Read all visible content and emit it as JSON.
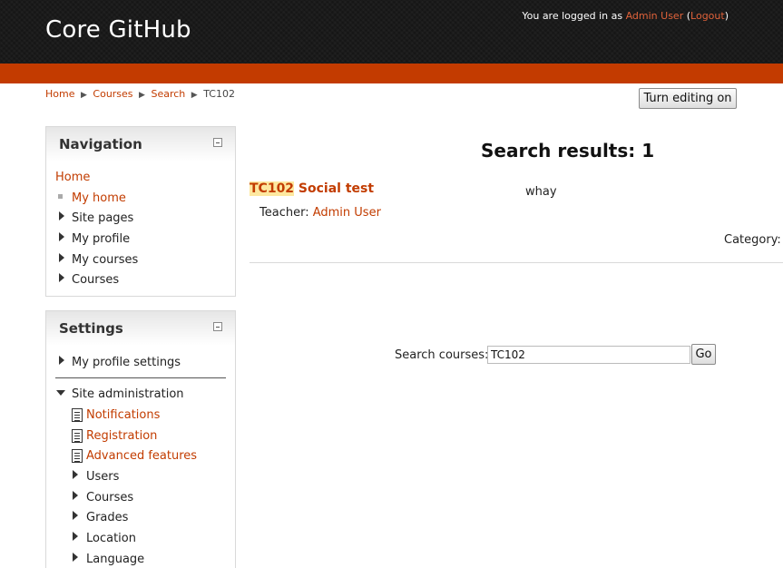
{
  "header": {
    "site_title": "Core GitHub",
    "login_prefix": "You are logged in as ",
    "user_name": "Admin User",
    "logout_open": " (",
    "logout_label": "Logout",
    "logout_close": ")"
  },
  "breadcrumb": {
    "items": [
      "Home",
      "Courses",
      "Search",
      "TC102"
    ],
    "separator": "▶"
  },
  "toolbar": {
    "edit_label": "Turn editing on"
  },
  "navigation": {
    "title": "Navigation",
    "home": "Home",
    "items": [
      "My home",
      "Site pages",
      "My profile",
      "My courses",
      "Courses"
    ]
  },
  "settings": {
    "title": "Settings",
    "profile_settings": "My profile settings",
    "site_admin": "Site administration",
    "pages": [
      "Notifications",
      "Registration",
      "Advanced features"
    ],
    "folders": [
      "Users",
      "Courses",
      "Grades",
      "Location",
      "Language"
    ]
  },
  "main": {
    "results_title": "Search results: 1",
    "course_code": "TC102",
    "course_name": " Social test",
    "course_summary": "whay",
    "teacher_label": "Teacher: ",
    "teacher_name": "Admin User",
    "category_label": "Category:",
    "search_label": "Search courses:",
    "search_value": "TC102",
    "go_label": "Go"
  },
  "colors": {
    "accent": "#c33b00",
    "link": "#c23c00",
    "header_bg": "#161616"
  }
}
